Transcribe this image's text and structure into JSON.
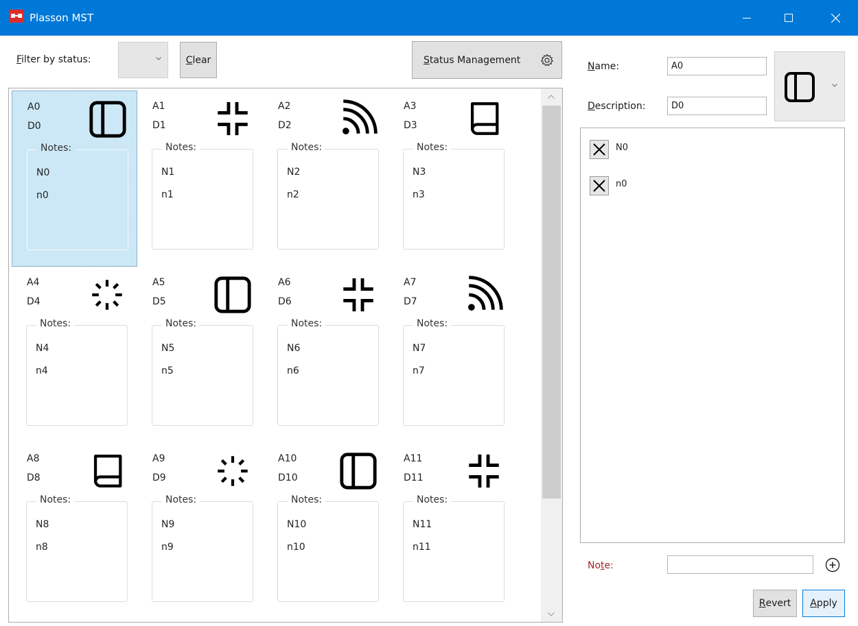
{
  "window": {
    "title": "Plasson MST"
  },
  "toolbar": {
    "filter_label": "Filter by status:",
    "filter_underline": "F",
    "filter_rest": "ilter by status:",
    "filter_value": "",
    "clear_underline": "C",
    "clear_rest": "lear",
    "status_mgmt_underline": "S",
    "status_mgmt_rest": "tatus Management"
  },
  "cards": [
    {
      "name": "A0",
      "description": "D0",
      "notes_label": "Notes:",
      "notes": [
        "N0",
        "n0"
      ],
      "icon": "panel-icon",
      "selected": true
    },
    {
      "name": "A1",
      "description": "D1",
      "notes_label": "Notes:",
      "notes": [
        "N1",
        "n1"
      ],
      "icon": "collapse-icon",
      "selected": false
    },
    {
      "name": "A2",
      "description": "D2",
      "notes_label": "Notes:",
      "notes": [
        "N2",
        "n2"
      ],
      "icon": "feed-icon",
      "selected": false
    },
    {
      "name": "A3",
      "description": "D3",
      "notes_label": "Notes:",
      "notes": [
        "N3",
        "n3"
      ],
      "icon": "book-icon",
      "selected": false
    },
    {
      "name": "A4",
      "description": "D4",
      "notes_label": "Notes:",
      "notes": [
        "N4",
        "n4"
      ],
      "icon": "loading-icon",
      "selected": false
    },
    {
      "name": "A5",
      "description": "D5",
      "notes_label": "Notes:",
      "notes": [
        "N5",
        "n5"
      ],
      "icon": "panel-icon",
      "selected": false
    },
    {
      "name": "A6",
      "description": "D6",
      "notes_label": "Notes:",
      "notes": [
        "N6",
        "n6"
      ],
      "icon": "collapse-icon",
      "selected": false
    },
    {
      "name": "A7",
      "description": "D7",
      "notes_label": "Notes:",
      "notes": [
        "N7",
        "n7"
      ],
      "icon": "feed-icon",
      "selected": false
    },
    {
      "name": "A8",
      "description": "D8",
      "notes_label": "Notes:",
      "notes": [
        "N8",
        "n8"
      ],
      "icon": "book-icon",
      "selected": false
    },
    {
      "name": "A9",
      "description": "D9",
      "notes_label": "Notes:",
      "notes": [
        "N9",
        "n9"
      ],
      "icon": "loading-icon",
      "selected": false
    },
    {
      "name": "A10",
      "description": "D10",
      "notes_label": "Notes:",
      "notes": [
        "N10",
        "n10"
      ],
      "icon": "panel-icon",
      "selected": false
    },
    {
      "name": "A11",
      "description": "D11",
      "notes_label": "Notes:",
      "notes": [
        "N11",
        "n11"
      ],
      "icon": "collapse-icon",
      "selected": false
    }
  ],
  "details": {
    "name_label_underline": "N",
    "name_label_rest": "ame:",
    "name_value": "A0",
    "description_label_underline": "D",
    "description_label_rest": "escription:",
    "description_value": "D0",
    "icon": "panel-icon",
    "notes": [
      "N0",
      "n0"
    ],
    "note_label_before": "No",
    "note_label_underline": "t",
    "note_label_after": "e:",
    "note_input_value": "",
    "note_label_color": "#a4262c",
    "revert_underline": "R",
    "revert_rest": "evert",
    "apply_underline": "A",
    "apply_rest": "pply"
  },
  "colors": {
    "titlebar": "#0078d7",
    "selection": "#cce8f6"
  }
}
